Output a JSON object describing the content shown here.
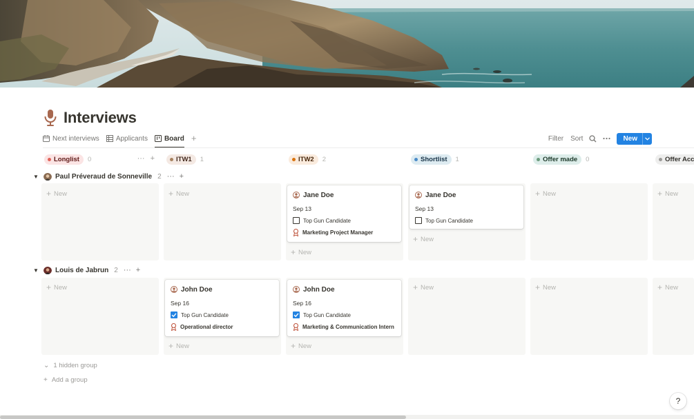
{
  "page": {
    "title": "Interviews",
    "icon": "microphone-icon"
  },
  "views": [
    {
      "label": "Next interviews",
      "icon": "calendar-icon",
      "active": false
    },
    {
      "label": "Applicants",
      "icon": "table-icon",
      "active": false
    },
    {
      "label": "Board",
      "icon": "board-icon",
      "active": true
    }
  ],
  "toolbar": {
    "add_view": "+",
    "filter_label": "Filter",
    "sort_label": "Sort",
    "search_icon": "search-icon",
    "more_icon": "more-icon",
    "new_label": "New"
  },
  "columns": [
    {
      "label": "Longlist",
      "count": "0",
      "bg": "#fbe4e4",
      "dot": "#e16259",
      "color": "#5d1715"
    },
    {
      "label": "ITW1",
      "count": "1",
      "bg": "#f4e9e3",
      "dot": "#a7825f",
      "color": "#442a1e"
    },
    {
      "label": "ITW2",
      "count": "2",
      "bg": "#faebdd",
      "dot": "#d9730d",
      "color": "#49290e"
    },
    {
      "label": "Shortlist",
      "count": "1",
      "bg": "#ddebf1",
      "dot": "#4b8bc8",
      "color": "#183347"
    },
    {
      "label": "Offer made",
      "count": "0",
      "bg": "#ddedea",
      "dot": "#6c9b7d",
      "color": "#1c3829"
    },
    {
      "label": "Offer Acce",
      "count": "",
      "bg": "#eeeeed",
      "dot": "#9b9a97",
      "color": "#32302c"
    }
  ],
  "column_header_actions": {
    "more": "···",
    "add": "+"
  },
  "groups": [
    {
      "name": "Paul Préveraud de Sonneville",
      "count": "2",
      "toggle": "▼",
      "more": "···",
      "add": "+"
    },
    {
      "name": "Louis de Jabrun",
      "count": "2",
      "toggle": "▼",
      "more": "···",
      "add": "+"
    }
  ],
  "cell_new_label": "New",
  "cards": [
    {
      "name": "Jane Doe",
      "date": "Sep 13",
      "checkbox_label": "Top Gun Candidate",
      "checked": false,
      "role": "Marketing Project Manager"
    },
    {
      "name": "Jane Doe",
      "date": "Sep 13",
      "checkbox_label": "Top Gun Candidate",
      "checked": false,
      "role": ""
    },
    {
      "name": "John Doe",
      "date": "Sep 16",
      "checkbox_label": "Top Gun Candidate",
      "checked": true,
      "role": "Operational director"
    },
    {
      "name": "John Doe",
      "date": "Sep 16",
      "checkbox_label": "Top Gun Candidate",
      "checked": true,
      "role": "Marketing & Communication Intern"
    }
  ],
  "footer": {
    "hidden_group_label": "1 hidden group",
    "add_group_label": "Add a group",
    "help_label": "?"
  },
  "colors": {
    "accent": "#2383e2",
    "text": "#37352f",
    "muted": "#9b9a97",
    "cell_bg": "#f7f7f5"
  }
}
